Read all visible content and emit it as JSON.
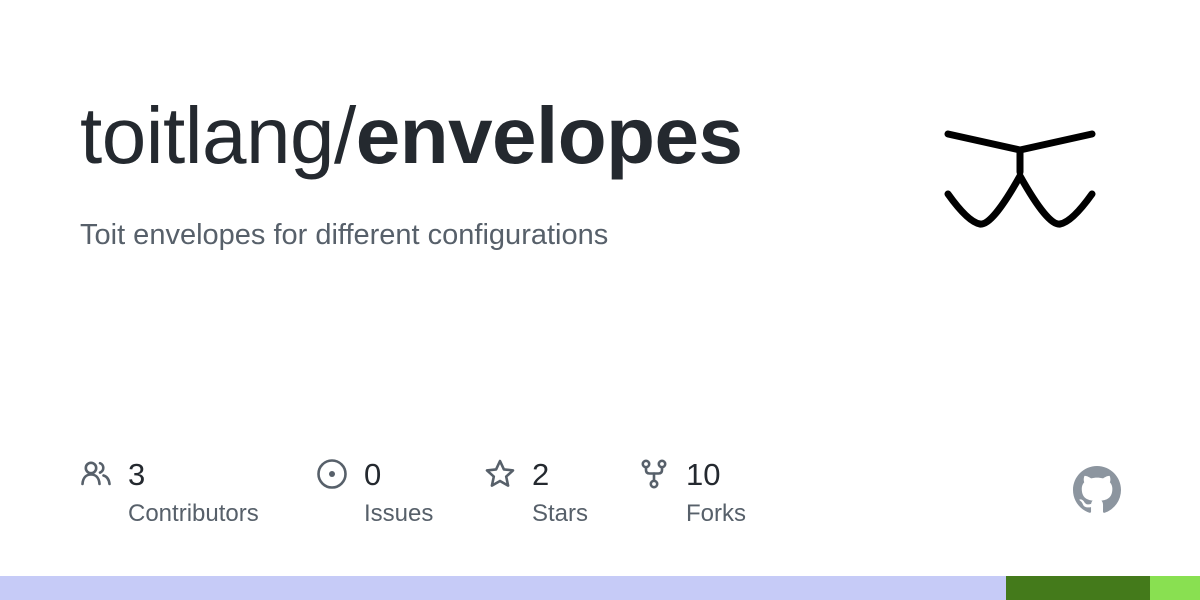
{
  "repo": {
    "owner": "toitlang/",
    "name": "envelopes",
    "description": "Toit envelopes for different configurations"
  },
  "stats": [
    {
      "icon": "people-icon",
      "value": "3",
      "label": "Contributors"
    },
    {
      "icon": "issue-opened-icon",
      "value": "0",
      "label": "Issues"
    },
    {
      "icon": "star-icon",
      "value": "2",
      "label": "Stars"
    },
    {
      "icon": "repo-forked-icon",
      "value": "10",
      "label": "Forks"
    }
  ],
  "colors": {
    "title": "#24292f",
    "muted": "#57606a",
    "icon": "#57606a",
    "github_mark": "#8c959f"
  },
  "language_bar": [
    {
      "color": "#c6cbf7",
      "fraction": 0.838
    },
    {
      "color": "#447a1b",
      "fraction": 0.12
    },
    {
      "color": "#89e051",
      "fraction": 0.042
    }
  ]
}
